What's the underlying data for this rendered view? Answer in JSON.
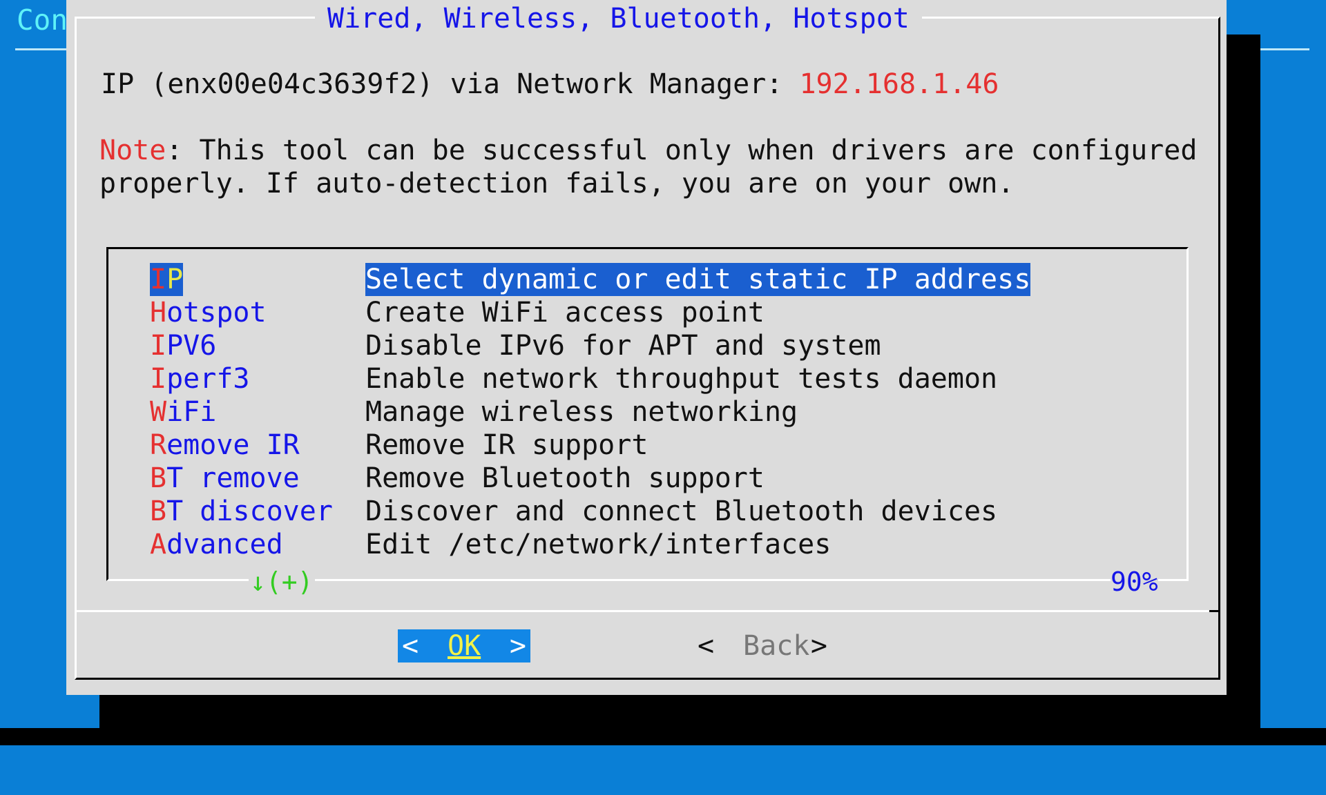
{
  "background": {
    "title": "Con"
  },
  "dialog": {
    "title": "Wired, Wireless, Bluetooth, Hotspot",
    "ip_prefix": "IP (enx00e04c3639f2) via Network Manager: ",
    "ip_value": "192.168.1.46",
    "note_label": "Note",
    "note_line1_rest": ": This tool can be successful only when drivers are configured",
    "note_line2": "properly. If auto-detection fails, you are on your own."
  },
  "menu": {
    "items": [
      {
        "tag_first": "I",
        "tag_rest": "P",
        "description": "Select dynamic or edit static IP address",
        "selected": true
      },
      {
        "tag_first": "H",
        "tag_rest": "otspot",
        "description": "Create WiFi access point"
      },
      {
        "tag_first": "I",
        "tag_rest": "PV6",
        "description": "Disable IPv6 for APT and system"
      },
      {
        "tag_first": "I",
        "tag_rest": "perf3",
        "description": "Enable network throughput tests daemon"
      },
      {
        "tag_first": "W",
        "tag_rest": "iFi",
        "description": "Manage wireless networking"
      },
      {
        "tag_first": "R",
        "tag_rest": "emove IR",
        "description": "Remove IR support"
      },
      {
        "tag_first": "B",
        "tag_rest": "T remove",
        "description": "Remove Bluetooth support"
      },
      {
        "tag_first": "B",
        "tag_rest": "T discover",
        "description": "Discover and connect Bluetooth devices"
      },
      {
        "tag_first": "A",
        "tag_rest": "dvanced",
        "description": "Edit /etc/network/interfaces"
      }
    ],
    "scroll_indicator": "↓(+)",
    "scroll_percent": "90%"
  },
  "buttons": {
    "ok": {
      "left": "<",
      "label": "OK",
      "right": ">"
    },
    "back": {
      "left": "<",
      "label": "Back",
      "right": ">"
    }
  },
  "colors": {
    "screen_background": "#0a7fd6",
    "dialog_background": "#dcdcdc",
    "title_text": "#1515e8",
    "highlight": "#e53030",
    "selection_background": "#1a5fd0",
    "button_active_background": "#1287e6"
  }
}
